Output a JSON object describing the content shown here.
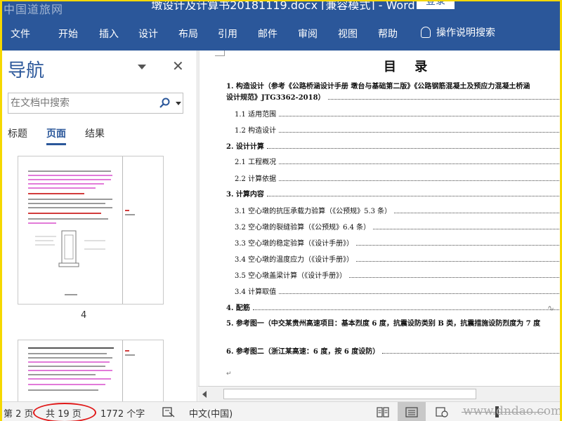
{
  "window": {
    "title": "墩设计及计算书20181119.docx [兼容模式] - Word",
    "login_label": "登录",
    "watermark_cn": "中国道旅网",
    "watermark_url": "www.dndao.com"
  },
  "ribbon": {
    "tabs": [
      "文件",
      "开始",
      "插入",
      "设计",
      "布局",
      "引用",
      "邮件",
      "审阅",
      "视图",
      "帮助"
    ],
    "tell_me": "操作说明搜索"
  },
  "nav_pane": {
    "title": "导航",
    "search_placeholder": "在文档中搜索",
    "tabs": [
      {
        "label": "标题",
        "active": false
      },
      {
        "label": "页面",
        "active": true
      },
      {
        "label": "结果",
        "active": false
      }
    ],
    "thumbnail_page": "4"
  },
  "document": {
    "heading": "目 录",
    "toc": [
      {
        "text": "1. 构造设计（参考《公路桥涵设计手册 墩台与基础第二版》《公路钢筋混凝土及预应力混凝土桥涵",
        "bold": true,
        "indent": 0
      },
      {
        "text": "设计规范》JTG3362-2018）",
        "bold": true,
        "indent": 0
      },
      {
        "text": "1.1 适用范围",
        "bold": false,
        "indent": 1
      },
      {
        "text": "1.2 构造设计",
        "bold": false,
        "indent": 1
      },
      {
        "text": "2. 设计计算",
        "bold": true,
        "indent": 0
      },
      {
        "text": "2.1 工程概况",
        "bold": false,
        "indent": 1
      },
      {
        "text": "2.2 计算依据",
        "bold": false,
        "indent": 1
      },
      {
        "text": "3. 计算内容",
        "bold": true,
        "indent": 0
      },
      {
        "text": "3.1 空心墩的抗压承载力验算（《公预规》5.3 条）",
        "bold": false,
        "indent": 1
      },
      {
        "text": "3.2 空心墩的裂缝验算（《公预规》6.4 条）",
        "bold": false,
        "indent": 1
      },
      {
        "text": "3.3 空心墩的稳定验算（《设计手册》）",
        "bold": false,
        "indent": 1
      },
      {
        "text": "3.4 空心墩的温度应力（《设计手册》）",
        "bold": false,
        "indent": 1
      },
      {
        "text": "3.5 空心墩盖梁计算（《设计手册》）",
        "bold": false,
        "indent": 1
      },
      {
        "text": "3.4 计算取值",
        "bold": false,
        "indent": 1
      },
      {
        "text": "4. 配筋",
        "bold": true,
        "indent": 0
      },
      {
        "text": "5. 参考图一（中交某贵州高速项目：基本烈度 6 度，抗震设防类别 B 类，抗震措施设防烈度为 7 度",
        "bold": true,
        "indent": 0
      },
      {
        "text": "6. 参考图二（浙江某高速：6 度，按 6 度设防）",
        "bold": true,
        "indent": 0
      }
    ]
  },
  "status": {
    "page": "第 2 页",
    "total": "共 19 页",
    "words": "1772 个字",
    "language": "中文(中国)"
  },
  "colors": {
    "ribbon": "#2b579a",
    "highlight_oval": "#e01818",
    "frame": "#f5d800"
  }
}
